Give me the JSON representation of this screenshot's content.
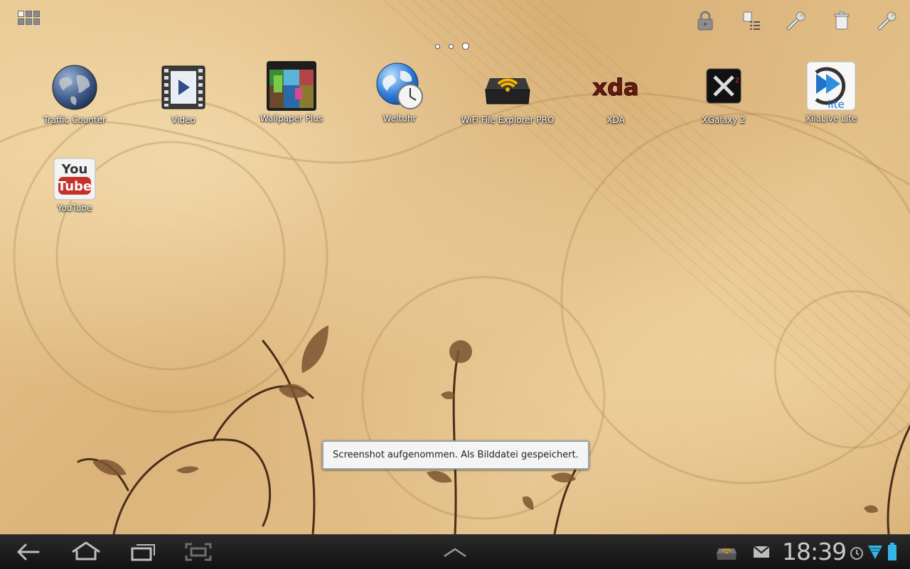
{
  "home": {
    "apps": [
      {
        "label": "Traffic Counter",
        "icon": "globe-icon"
      },
      {
        "label": "Video",
        "icon": "film-play-icon"
      },
      {
        "label": "Wallpaper Plus",
        "icon": "wallpaper-icon"
      },
      {
        "label": "Weltuhr",
        "icon": "world-clock-icon"
      },
      {
        "label": "WiFi File Explorer PRO",
        "icon": "wifi-router-icon"
      },
      {
        "label": "XDA",
        "icon": "xda-logo-icon",
        "logo_text": "xda"
      },
      {
        "label": "XGalaxy 2",
        "icon": "xgalaxy-icon"
      },
      {
        "label": "XiiaLive Lite",
        "icon": "xiialive-icon",
        "logo_text": "lite"
      },
      {
        "label": "YouTube",
        "icon": "youtube-icon",
        "logo_text_top": "You",
        "logo_text_bottom": "Tube"
      }
    ],
    "page_indicator": {
      "pages": 3,
      "current": 3
    }
  },
  "toast": {
    "text": "Screenshot aufgenommen. Als Bilddatei gespeichert."
  },
  "status_bar": {
    "time": "18:39",
    "icons": [
      "wifi-router-icon",
      "gmail-icon",
      "alarm-icon",
      "wifi-signal-icon",
      "battery-icon"
    ]
  },
  "nav_bar": {
    "buttons": [
      "back-icon",
      "home-icon",
      "recent-apps-icon",
      "screenshot-icon",
      "up-arrow-icon"
    ]
  },
  "colors": {
    "accent": "#33b5e5",
    "toast_border": "#9aa6b0",
    "bar": "#1a1a1a"
  }
}
